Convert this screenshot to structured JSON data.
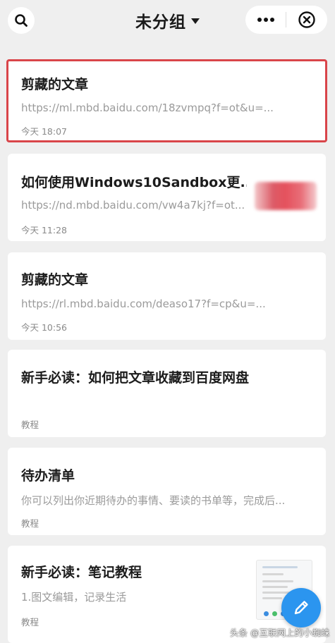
{
  "header": {
    "title": "未分组",
    "icons": {
      "search": "search-icon",
      "more": "more-dots-icon",
      "close": "close-circle-icon",
      "dropdown": "caret-down-icon"
    }
  },
  "cards": [
    {
      "title": "剪藏的文章",
      "url": "https://ml.mbd.baidu.com/18zvmpq?f=ot&u=...",
      "time": "今天 18:07",
      "highlighted": true
    },
    {
      "title": "如何使用Windows10Sandbox更...",
      "url": "https://nd.mbd.baidu.com/vw4a7kj?f=ot...",
      "time": "今天 11:28",
      "thumbnail": "blurred-image"
    },
    {
      "title": "剪藏的文章",
      "url": "https://rl.mbd.baidu.com/deaso17?f=cp&u=...",
      "time": "今天 10:56"
    },
    {
      "title": "新手必读：如何把文章收藏到百度网盘",
      "url": "",
      "time": "教程"
    },
    {
      "title": "待办清单",
      "url": "你可以列出你近期待办的事情、要读的书单等，完成后...",
      "time": "教程"
    },
    {
      "title": "新手必读：笔记教程",
      "url": "1.图文编辑，记录生活",
      "time": "教程",
      "thumbnail": "document-preview"
    }
  ],
  "fab": {
    "icon": "pencil-icon",
    "color": "#2b95ef"
  },
  "watermark": "头条 @互联网上的小蜘蛛",
  "colors": {
    "highlight_border": "#d9454a",
    "background": "#efefef"
  }
}
